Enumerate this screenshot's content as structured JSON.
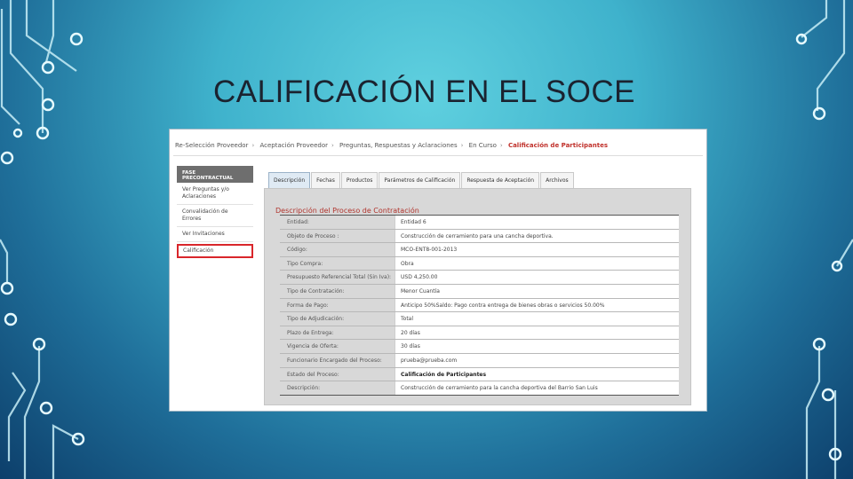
{
  "slide": {
    "title": "CALIFICACIÓN EN EL SOCE"
  },
  "breadcrumb": [
    "Re-Selección Proveedor",
    "Aceptación Proveedor",
    "Preguntas, Respuestas y Aclaraciones",
    "En Curso",
    "Calificación de Participantes"
  ],
  "sidebar": {
    "header": "FASE PRECONTRACTUAL",
    "items": [
      {
        "label": "Ver Preguntas y/o Aclaraciones"
      },
      {
        "label": "Convalidación de Errores"
      },
      {
        "label": "Ver Invitaciones"
      },
      {
        "label": "Calificación"
      }
    ]
  },
  "tabs": [
    "Descripción",
    "Fechas",
    "Productos",
    "Parámetros de Calificación",
    "Respuesta de Aceptación",
    "Archivos"
  ],
  "section_title": "Descripción del Proceso de Contratación",
  "fields": [
    {
      "label": "Entidad:",
      "value": "Entidad 6"
    },
    {
      "label": "Objeto de Proceso :",
      "value": "Construcción de cerramiento para una cancha deportiva."
    },
    {
      "label": "Código:",
      "value": "MCO-ENT8-001-2013"
    },
    {
      "label": "Tipo Compra:",
      "value": "Obra"
    },
    {
      "label": "Presupuesto Referencial Total (Sin Iva):",
      "value": "USD 4,250.00"
    },
    {
      "label": "Tipo de Contratación:",
      "value": "Menor Cuantía"
    },
    {
      "label": "Forma de Pago:",
      "value": "Anticipo 50%Saldo: Pago contra entrega de bienes obras o servicios 50.00%"
    },
    {
      "label": "Tipo de Adjudicación:",
      "value": "Total"
    },
    {
      "label": "Plazo de Entrega:",
      "value": "20 días"
    },
    {
      "label": "Vigencia de Oferta:",
      "value": "30 días"
    },
    {
      "label": "Funcionario Encargado del Proceso:",
      "value": "prueba@prueba.com"
    },
    {
      "label": "Estado del Proceso:",
      "value": "Calificación de Participantes"
    },
    {
      "label": "Descripción:",
      "value": "Construcción de cerramiento para la cancha deportiva del Barrio San Luis"
    }
  ]
}
